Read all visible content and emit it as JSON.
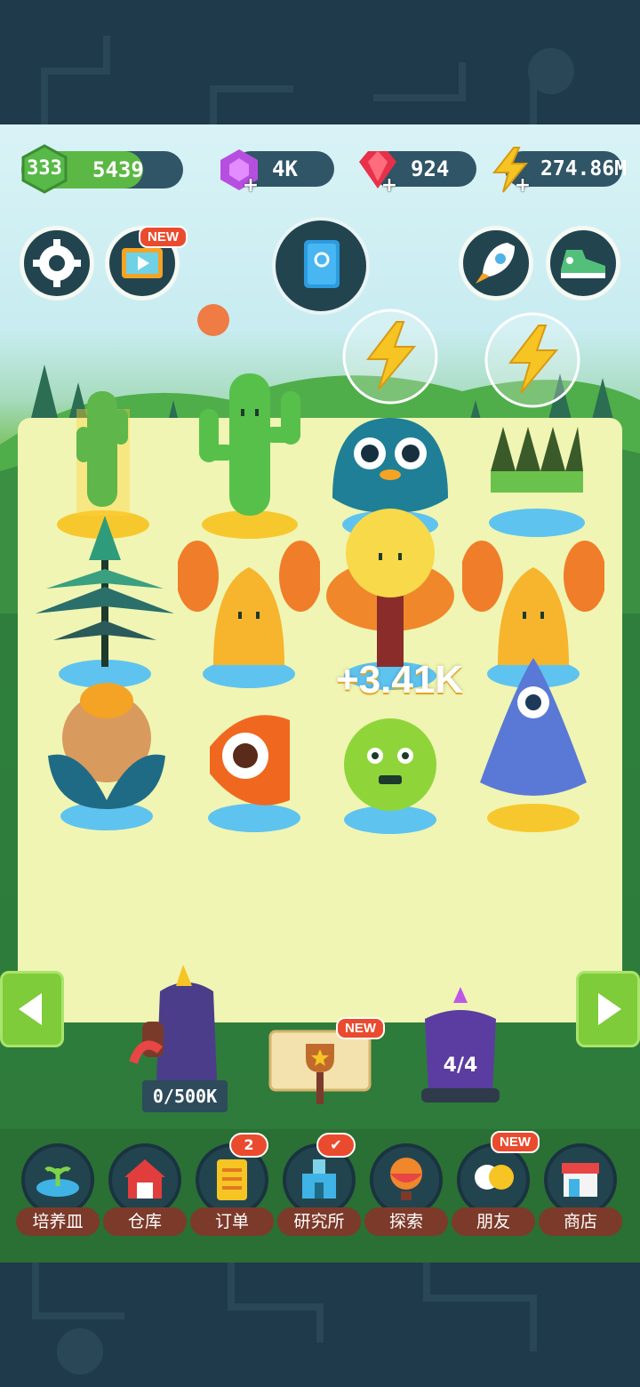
{
  "resources": {
    "level": "333",
    "level_progress": 0.75,
    "coins": "5439",
    "gems_purple": "4K",
    "rubies": "924",
    "energy": "274.86M"
  },
  "tags": {
    "video_new": "NEW",
    "trophy_new": "NEW",
    "friends_new": "NEW"
  },
  "floating": {
    "income_popup": "+3.41K"
  },
  "farm": {
    "collector_counter": "0/500K",
    "portal_counter": "4/4"
  },
  "nav": {
    "items": [
      {
        "label": "培养皿",
        "icon": "petri-dish-icon"
      },
      {
        "label": "仓库",
        "icon": "warehouse-icon"
      },
      {
        "label": "订单",
        "icon": "scroll-icon",
        "badge": "2"
      },
      {
        "label": "研究所",
        "icon": "lab-icon"
      },
      {
        "label": "探索",
        "icon": "balloon-icon"
      },
      {
        "label": "朋友",
        "icon": "friends-icon"
      },
      {
        "label": "商店",
        "icon": "shop-icon"
      }
    ]
  },
  "colors": {
    "panel": "#2f5566",
    "accent_green": "#5cb844",
    "badge_red": "#ea4b2e",
    "field": "#f0f5b3"
  }
}
